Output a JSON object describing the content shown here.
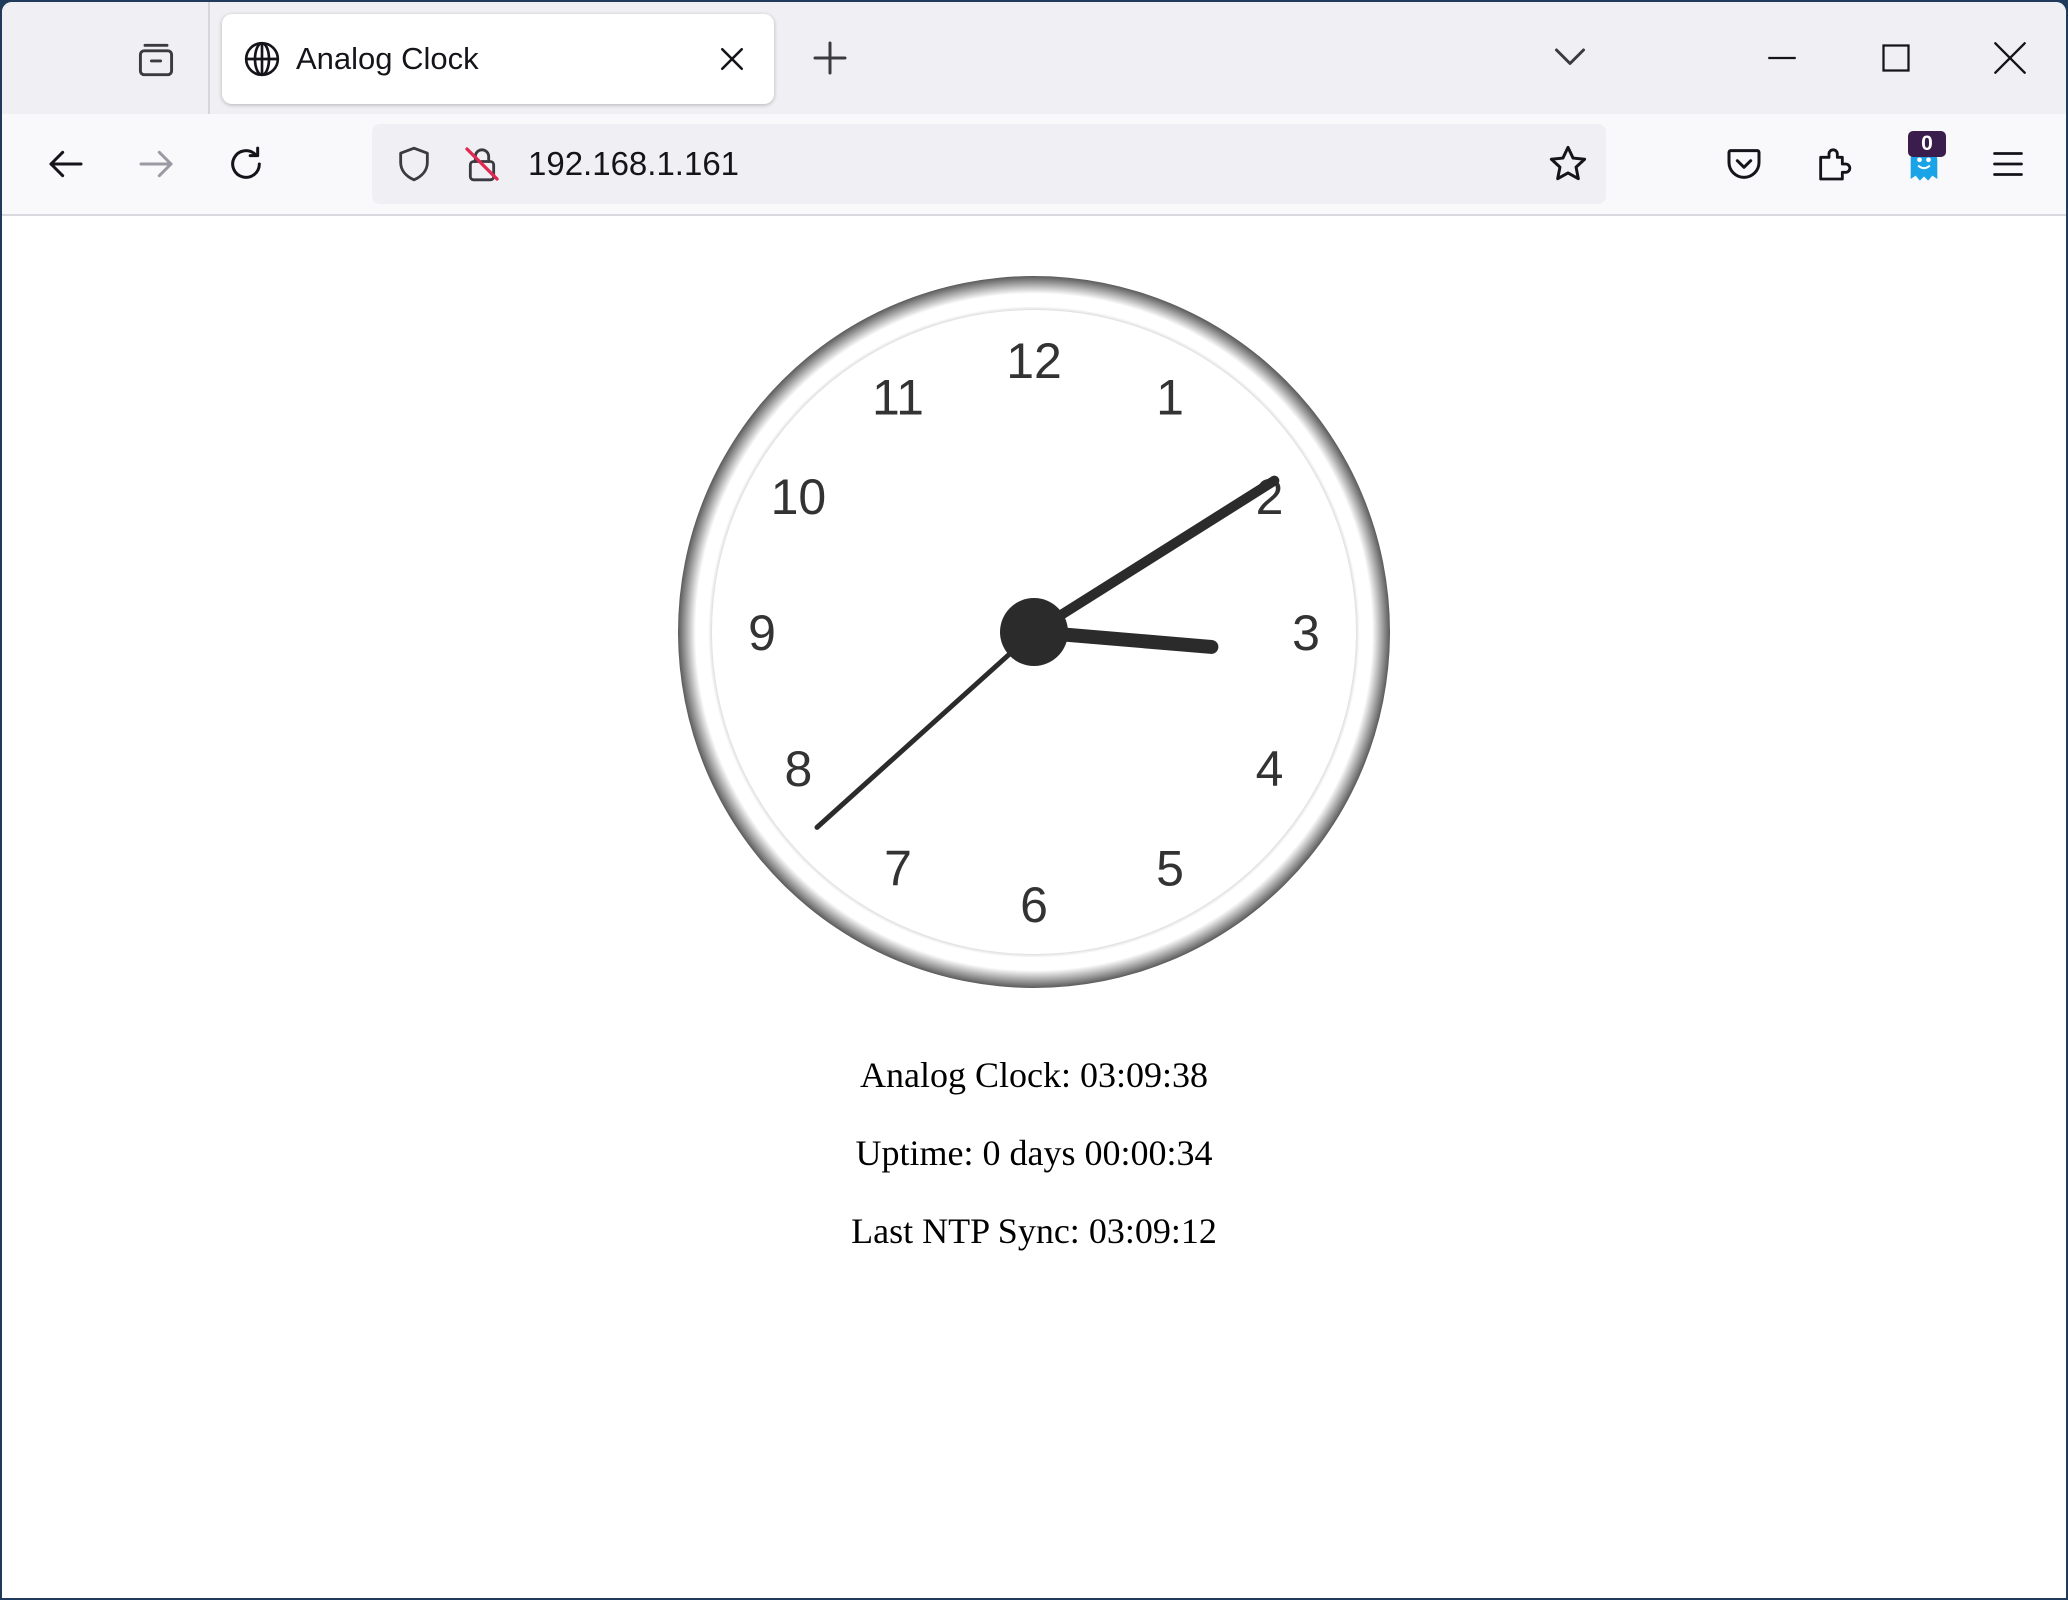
{
  "browser": {
    "tab": {
      "title": "Analog Clock"
    },
    "address_bar": {
      "url": "192.168.1.161"
    },
    "extensions": {
      "ghostery_badge": "0"
    }
  },
  "page": {
    "clock": {
      "time": {
        "hours": 3,
        "minutes": 9,
        "seconds": 38
      },
      "numerals": [
        "12",
        "1",
        "2",
        "3",
        "4",
        "5",
        "6",
        "7",
        "8",
        "9",
        "10",
        "11"
      ],
      "colors": {
        "hands": "#2b2b2b",
        "rim_dark": "#5e5e5e",
        "rim_light": "#ffffff",
        "face": "#ffffff"
      }
    },
    "status": {
      "clock_line": "Analog Clock: 03:09:38",
      "uptime_line": "Uptime: 0 days 00:00:34",
      "ntp_line": "Last NTP Sync: 03:09:12"
    }
  }
}
